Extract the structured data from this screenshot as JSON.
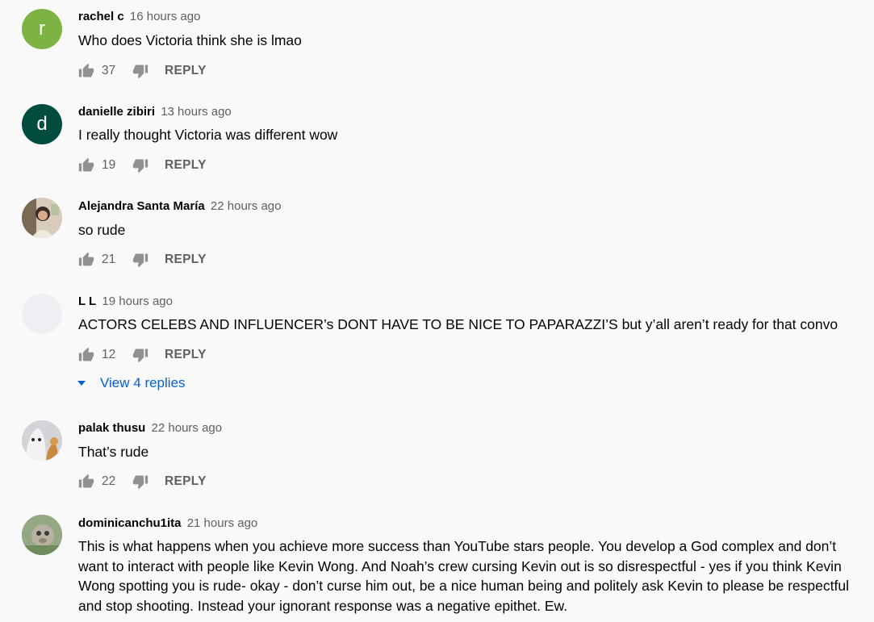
{
  "comments": [
    {
      "author": "rachel c",
      "time": "16 hours ago",
      "text": "Who does Victoria think she is lmao",
      "likes": "37",
      "reply_label": "REPLY",
      "avatar_letter": "r",
      "avatar_color": "#7cb342"
    },
    {
      "author": "danielle zibiri",
      "time": "13 hours ago",
      "text": "I really thought Victoria was different wow",
      "likes": "19",
      "reply_label": "REPLY",
      "avatar_letter": "d",
      "avatar_color": "#004d40"
    },
    {
      "author": "Alejandra Santa María",
      "time": "22 hours ago",
      "text": "so rude",
      "likes": "21",
      "reply_label": "REPLY"
    },
    {
      "author": "L L",
      "time": "19 hours ago",
      "text": "ACTORS CELEBS AND INFLUENCER’s DONT HAVE TO BE NICE TO PAPARAZZI’S but y’all aren’t ready for that convo",
      "likes": "12",
      "reply_label": "REPLY",
      "view_replies_label": "View 4 replies"
    },
    {
      "author": "palak thusu",
      "time": "22 hours ago",
      "text": "That’s rude",
      "likes": "22",
      "reply_label": "REPLY"
    },
    {
      "author": "dominicanchu1ita",
      "time": "21 hours ago",
      "text": "This is what happens when you achieve more success than YouTube stars people. You develop a God complex and don’t want to interact with people like Kevin Wong.  And Noah’s crew cursing Kevin out is so disrespectful - yes if you think Kevin Wong spotting you is rude- okay - don’t curse him out, be a nice human being and politely ask Kevin to please be respectful and stop shooting. Instead your ignorant response was a negative epithet. Ew."
    }
  ],
  "colors": {
    "background": "#f9f9f9",
    "link": "#065fd4",
    "secondary_text": "#606060"
  }
}
